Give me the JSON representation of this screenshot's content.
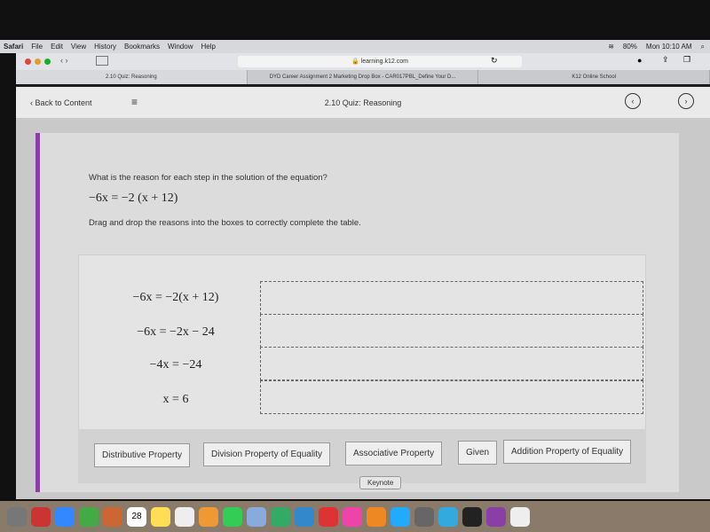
{
  "menubar": {
    "app": "Safari",
    "items": [
      "File",
      "Edit",
      "View",
      "History",
      "Bookmarks",
      "Window",
      "Help"
    ],
    "battery": "80%",
    "clock": "Mon 10:10 AM"
  },
  "browser": {
    "url": "learning.k12.com",
    "tabs": [
      "2.10 Quiz: Reasoning",
      "DYD Career Assignment 2 Marketing Drop Box - CAR017PBL_Define Your D...",
      "K12 Online School"
    ]
  },
  "header": {
    "back": "Back to Content",
    "title": "2.10 Quiz: Reasoning"
  },
  "question": {
    "prompt": "What is the reason for each step in the solution of the equation?",
    "equation": "−6x = −2 (x + 12)",
    "instruction": "Drag and drop the reasons into the boxes to correctly complete the table."
  },
  "steps": [
    "−6x = −2(x + 12)",
    "−6x = −2x − 24",
    "−4x = −24",
    "x = 6"
  ],
  "reasons": [
    "Distributive Property",
    "Division Property of Equality",
    "Associative Property",
    "Given",
    "Addition Property of Equality"
  ],
  "tooltip": "Keynote",
  "dock": {
    "calendar_day": "28",
    "accent": "#8a3fa8"
  }
}
